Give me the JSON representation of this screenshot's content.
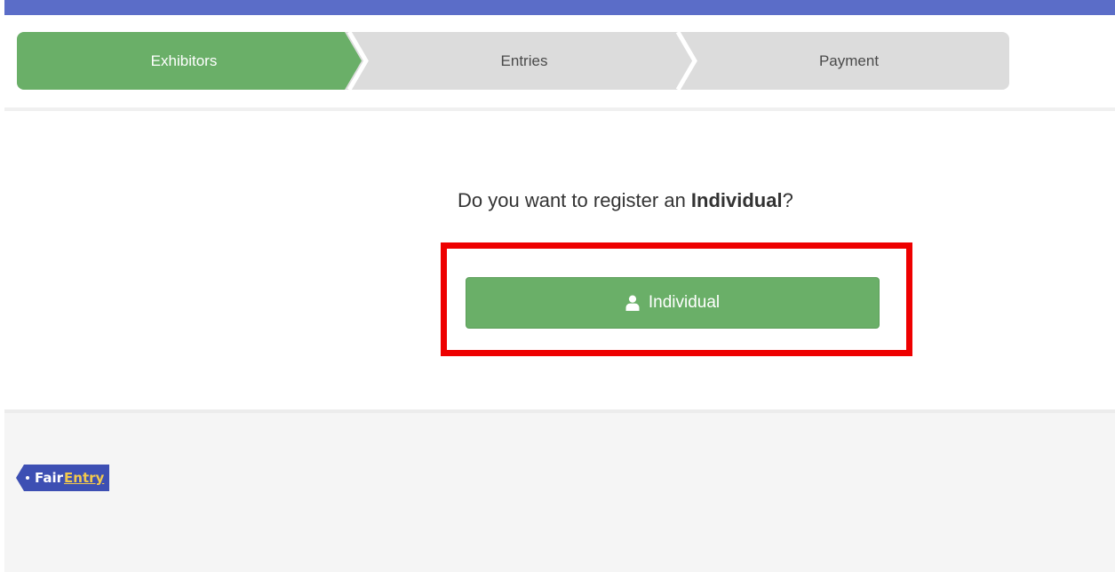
{
  "steps": {
    "items": [
      {
        "label": "Exhibitors",
        "state": "active"
      },
      {
        "label": "Entries",
        "state": "inactive"
      },
      {
        "label": "Payment",
        "state": "inactive"
      }
    ]
  },
  "prompt": {
    "prefix": "Do you want to register an ",
    "strong": "Individual",
    "suffix": "?"
  },
  "individual_button": {
    "label": "Individual",
    "icon": "user-icon"
  },
  "footer": {
    "logo_text_1": "Fair",
    "logo_text_2": "Entry"
  },
  "colors": {
    "top_bar": "#5b6dc8",
    "step_active": "#6aaf68",
    "step_inactive": "#dcdcdc",
    "button": "#6aaf68",
    "highlight": "#ee0000",
    "logo_bg": "#3d4fb3",
    "logo_accent": "#f2c94c"
  }
}
